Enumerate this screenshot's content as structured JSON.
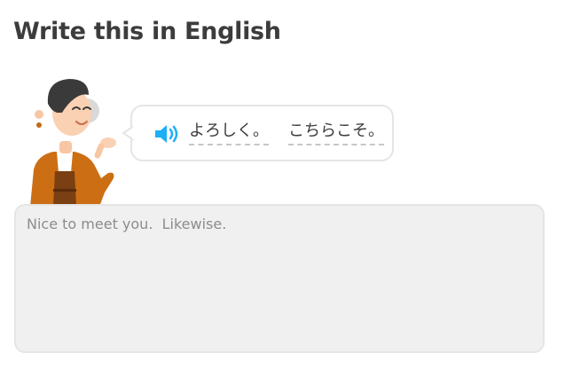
{
  "header": {
    "title": "Write this in English"
  },
  "prompt": {
    "character_icon": "character-illustration",
    "speaker_icon": "speaker-icon",
    "tokens": [
      "よろしく。",
      "こちらこそ。"
    ]
  },
  "answer": {
    "value": "Nice to meet you.  Likewise.",
    "placeholder": ""
  },
  "colors": {
    "title": "#3c3c3c",
    "speaker": "#1cb0f6",
    "input_bg": "#f0f0f0",
    "border": "#e5e5e5"
  }
}
